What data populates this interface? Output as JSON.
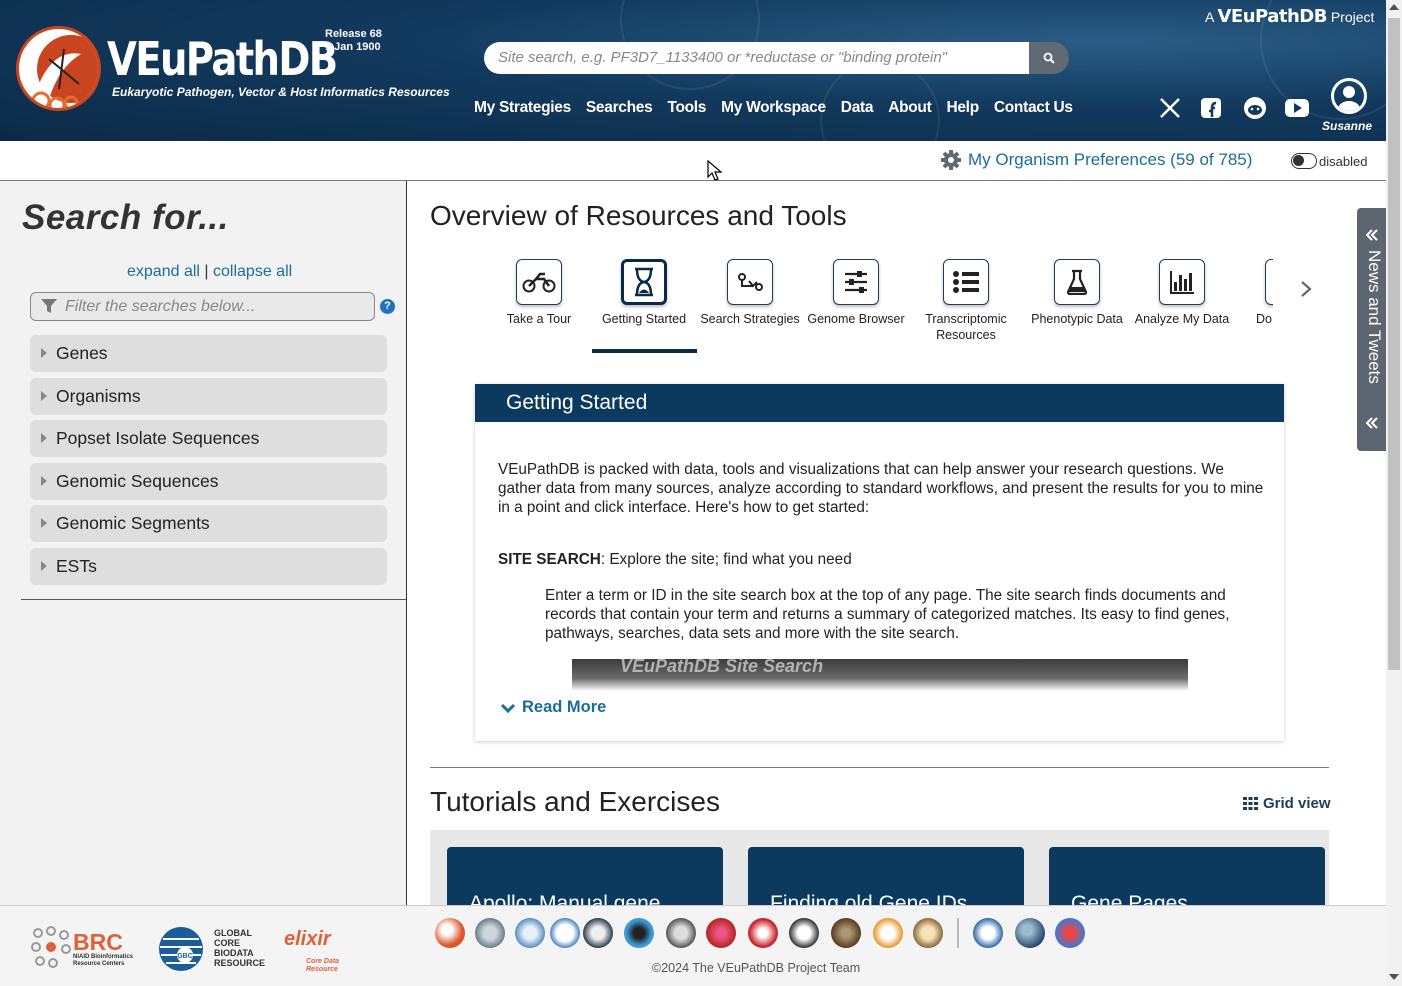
{
  "header": {
    "logo_title": "VEuPathDB",
    "logo_subtitle": "Eukaryotic Pathogen, Vector & Host Informatics Resources",
    "release_label": "Release 68",
    "release_date": "1 Jan 1900",
    "project_prefix": "A",
    "project_name": "VEuPathDB",
    "project_suffix": "Project",
    "search_placeholder": "Site search, e.g. PF3D7_1133400 or *reductase or \"binding protein\"",
    "nav": [
      "My Strategies",
      "Searches",
      "Tools",
      "My Workspace",
      "Data",
      "About",
      "Help",
      "Contact Us"
    ],
    "username": "Susanne"
  },
  "prefs": {
    "label": "My Organism Preferences (59 of 785)",
    "toggle_label": "disabled"
  },
  "sidebar": {
    "title": "Search for...",
    "expand_all": "expand all",
    "separator": "|",
    "collapse_all": "collapse all",
    "filter_placeholder": "Filter the searches below...",
    "help": "?",
    "items": [
      "Genes",
      "Organisms",
      "Popset Isolate Sequences",
      "Genomic Sequences",
      "Genomic Segments",
      "ESTs"
    ]
  },
  "main": {
    "title": "Overview of Resources and Tools",
    "tools": [
      {
        "label": "Take a Tour",
        "icon": "motorcycle-icon"
      },
      {
        "label": "Getting Started",
        "icon": "hourglass-icon"
      },
      {
        "label": "Search Strategies",
        "icon": "strategy-icon"
      },
      {
        "label": "Genome Browser",
        "icon": "sliders-icon"
      },
      {
        "label": "Transcriptomic Resources",
        "icon": "list-icon"
      },
      {
        "label": "Phenotypic Data",
        "icon": "flask-icon"
      },
      {
        "label": "Analyze My Data",
        "icon": "bar-chart-icon"
      },
      {
        "label": "Do",
        "icon": "download-icon"
      }
    ],
    "active_tool": "Getting Started",
    "getting_started": {
      "heading": "Getting Started",
      "intro": "VEuPathDB is packed with data, tools and visualizations that can help answer your research questions. We gather data from many sources, analyze according to standard workflows, and present the results for you to mine in a point and click interface. Here's how to get started:",
      "site_search_label": "SITE SEARCH",
      "site_search_text": ": Explore the site; find what you need",
      "site_search_detail": "Enter a term or ID in the site search box at the top of any page. The site search finds documents and records that contain your term and returns a summary of categorized matches. Its easy to find genes, pathways, searches, data sets and more with the site search.",
      "video_text": "VEuPathDB Site Search",
      "read_more": "Read More"
    },
    "tutorials_title": "Tutorials and Exercises",
    "grid_view": "Grid view",
    "tutorials": [
      "Apollo: Manual gene",
      "Finding old Gene IDs",
      "Gene Pages"
    ]
  },
  "news_tab": "News and Tweets",
  "footer": {
    "brc": "BRC",
    "brc_sub": "NIAID Bioinformatics Resource Centers",
    "gbc": "GLOBAL CORE BIODATA RESOURCE",
    "elixir": "elixir",
    "elixir_sub": "Core Data Resource",
    "copyright": "©2024 The VEuPathDB Project Team"
  },
  "colors": {
    "header_dark": "#0b2a47",
    "link": "#1a6e99",
    "card_header": "#0b3a5e",
    "accent_orange": "#e0603c"
  }
}
